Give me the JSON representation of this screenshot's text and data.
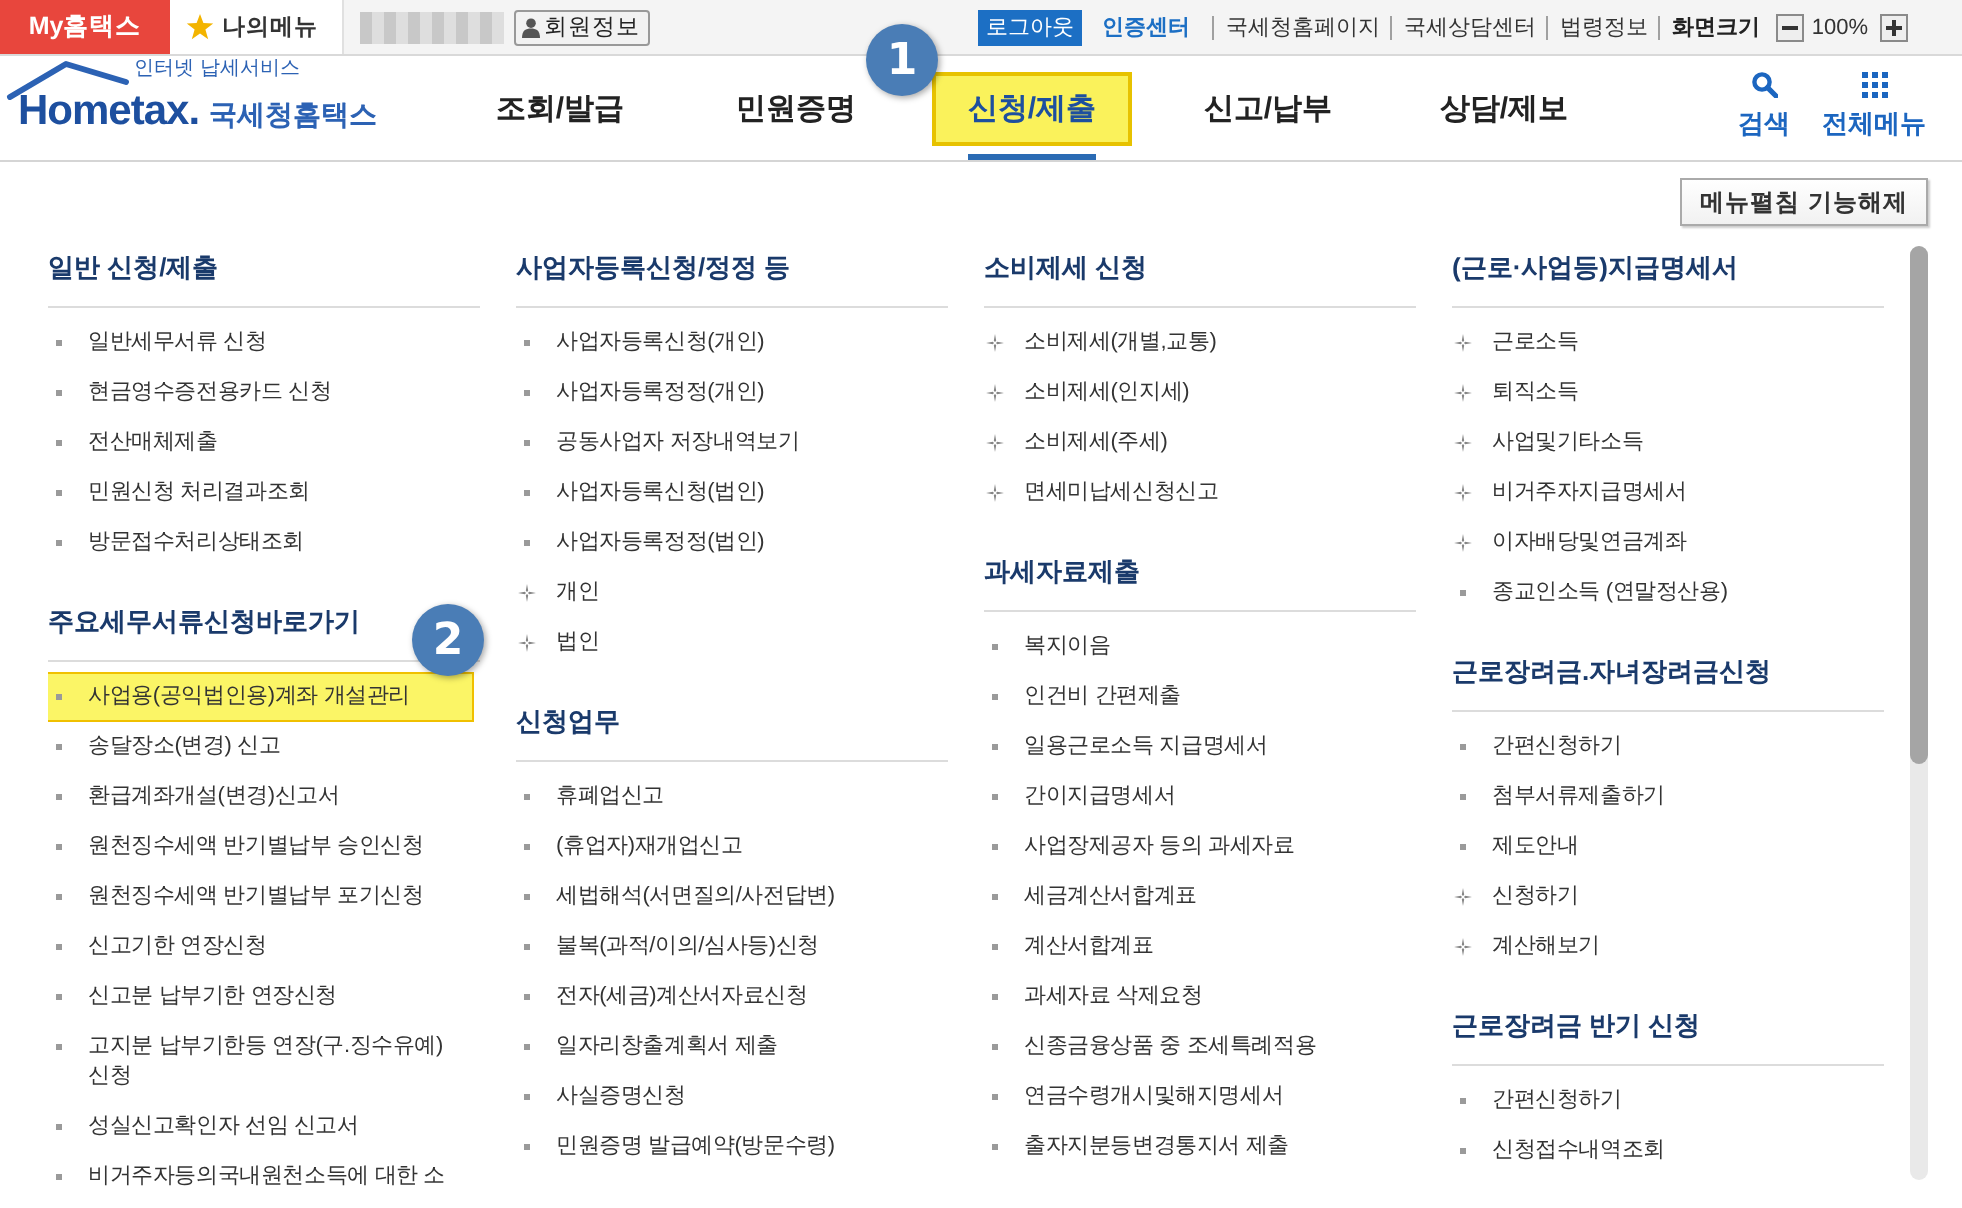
{
  "top_bar": {
    "my_hometax": "My홈택스",
    "my_menu": "나의메뉴",
    "member_info": "회원정보",
    "logout": "로그아웃",
    "cert_center": "인증센터",
    "links": [
      "국세청홈페이지",
      "국세상담센터",
      "법령정보"
    ],
    "screen_size": {
      "label": "화면크기",
      "value": "100%"
    }
  },
  "logo": {
    "tagline": "인터넷 납세서비스",
    "wordmark": "Hometax.",
    "title": "국세청홈택스"
  },
  "nav": {
    "tabs": [
      {
        "label": "조회/발급",
        "selected": false
      },
      {
        "label": "민원증명",
        "selected": false
      },
      {
        "label": "신청/제출",
        "selected": true,
        "marker": "1"
      },
      {
        "label": "신고/납부",
        "selected": false
      },
      {
        "label": "상담/제보",
        "selected": false
      }
    ],
    "search": "검색",
    "all_menu": "전체메뉴"
  },
  "collapse_button": "메뉴펼침 기능해제",
  "columns": [
    {
      "sections": [
        {
          "title": "일반 신청/제출",
          "items": [
            {
              "label": "일반세무서류 신청",
              "kind": "page",
              "highlighted": false
            },
            {
              "label": "현금영수증전용카드 신청",
              "kind": "page",
              "highlighted": false
            },
            {
              "label": "전산매체제출",
              "kind": "page",
              "highlighted": false
            },
            {
              "label": "민원신청 처리결과조회",
              "kind": "page",
              "highlighted": false
            },
            {
              "label": "방문접수처리상태조회",
              "kind": "page",
              "highlighted": false
            }
          ]
        },
        {
          "title": "주요세무서류신청바로가기",
          "items": [
            {
              "label": "사업용(공익법인용)계좌 개설관리",
              "kind": "page",
              "highlighted": true,
              "marker": "2"
            },
            {
              "label": "송달장소(변경) 신고",
              "kind": "page",
              "highlighted": false
            },
            {
              "label": "환급계좌개설(변경)신고서",
              "kind": "page",
              "highlighted": false
            },
            {
              "label": "원천징수세액 반기별납부 승인신청",
              "kind": "page",
              "highlighted": false
            },
            {
              "label": "원천징수세액 반기별납부 포기신청",
              "kind": "page",
              "highlighted": false
            },
            {
              "label": "신고기한 연장신청",
              "kind": "page",
              "highlighted": false
            },
            {
              "label": "신고분 납부기한 연장신청",
              "kind": "page",
              "highlighted": false
            },
            {
              "label": "고지분 납부기한등 연장(구.징수유예) 신청",
              "kind": "page",
              "highlighted": false
            },
            {
              "label": "성실신고확인자 선임 신고서",
              "kind": "page",
              "highlighted": false
            },
            {
              "label": "비거주자등의국내원천소득에 대한 소",
              "kind": "page",
              "highlighted": false
            }
          ]
        }
      ]
    },
    {
      "sections": [
        {
          "title": "사업자등록신청/정정 등",
          "items": [
            {
              "label": "사업자등록신청(개인)",
              "kind": "page",
              "highlighted": false
            },
            {
              "label": "사업자등록정정(개인)",
              "kind": "page",
              "highlighted": false
            },
            {
              "label": "공동사업자 저장내역보기",
              "kind": "page",
              "highlighted": false
            },
            {
              "label": "사업자등록신청(법인)",
              "kind": "page",
              "highlighted": false
            },
            {
              "label": "사업자등록정정(법인)",
              "kind": "page",
              "highlighted": false
            },
            {
              "label": "개인",
              "kind": "group",
              "highlighted": false
            },
            {
              "label": "법인",
              "kind": "group",
              "highlighted": false
            }
          ]
        },
        {
          "title": "신청업무",
          "items": [
            {
              "label": "휴폐업신고",
              "kind": "page",
              "highlighted": false
            },
            {
              "label": "(휴업자)재개업신고",
              "kind": "page",
              "highlighted": false
            },
            {
              "label": "세법해석(서면질의/사전답변)",
              "kind": "page",
              "highlighted": false
            },
            {
              "label": "불복(과적/이의/심사등)신청",
              "kind": "page",
              "highlighted": false
            },
            {
              "label": "전자(세금)계산서자료신청",
              "kind": "page",
              "highlighted": false
            },
            {
              "label": "일자리창출계획서 제출",
              "kind": "page",
              "highlighted": false
            },
            {
              "label": "사실증명신청",
              "kind": "page",
              "highlighted": false
            },
            {
              "label": "민원증명 발급예약(방문수령)",
              "kind": "page",
              "highlighted": false
            }
          ]
        }
      ]
    },
    {
      "sections": [
        {
          "title": "소비제세 신청",
          "items": [
            {
              "label": "소비제세(개별,교통)",
              "kind": "group",
              "highlighted": false
            },
            {
              "label": "소비제세(인지세)",
              "kind": "group",
              "highlighted": false
            },
            {
              "label": "소비제세(주세)",
              "kind": "group",
              "highlighted": false
            },
            {
              "label": "면세미납세신청신고",
              "kind": "group",
              "highlighted": false
            }
          ]
        },
        {
          "title": "과세자료제출",
          "items": [
            {
              "label": "복지이음",
              "kind": "page",
              "highlighted": false
            },
            {
              "label": "인건비 간편제출",
              "kind": "page",
              "highlighted": false
            },
            {
              "label": "일용근로소득 지급명세서",
              "kind": "page",
              "highlighted": false
            },
            {
              "label": "간이지급명세서",
              "kind": "page",
              "highlighted": false
            },
            {
              "label": "사업장제공자 등의 과세자료",
              "kind": "page",
              "highlighted": false
            },
            {
              "label": "세금계산서합계표",
              "kind": "page",
              "highlighted": false
            },
            {
              "label": "계산서합계표",
              "kind": "page",
              "highlighted": false
            },
            {
              "label": "과세자료 삭제요청",
              "kind": "page",
              "highlighted": false
            },
            {
              "label": "신종금융상품 중 조세특례적용",
              "kind": "page",
              "highlighted": false
            },
            {
              "label": "연금수령개시및해지명세서",
              "kind": "page",
              "highlighted": false
            },
            {
              "label": "출자지분등변경통지서 제출",
              "kind": "page",
              "highlighted": false
            }
          ]
        }
      ]
    },
    {
      "sections": [
        {
          "title": "(근로·사업등)지급명세서",
          "items": [
            {
              "label": "근로소득",
              "kind": "group",
              "highlighted": false
            },
            {
              "label": "퇴직소득",
              "kind": "group",
              "highlighted": false
            },
            {
              "label": "사업및기타소득",
              "kind": "group",
              "highlighted": false
            },
            {
              "label": "비거주자지급명세서",
              "kind": "group",
              "highlighted": false
            },
            {
              "label": "이자배당및연금계좌",
              "kind": "group",
              "highlighted": false
            },
            {
              "label": "종교인소득 (연말정산용)",
              "kind": "page",
              "highlighted": false
            }
          ]
        },
        {
          "title": "근로장려금.자녀장려금신청",
          "items": [
            {
              "label": "간편신청하기",
              "kind": "page",
              "highlighted": false
            },
            {
              "label": "첨부서류제출하기",
              "kind": "page",
              "highlighted": false
            },
            {
              "label": "제도안내",
              "kind": "page",
              "highlighted": false
            },
            {
              "label": "신청하기",
              "kind": "group",
              "highlighted": false
            },
            {
              "label": "계산해보기",
              "kind": "group",
              "highlighted": false
            }
          ]
        },
        {
          "title": "근로장려금 반기 신청",
          "items": [
            {
              "label": "간편신청하기",
              "kind": "page",
              "highlighted": false
            },
            {
              "label": "신청접수내역조회",
              "kind": "page",
              "highlighted": false
            }
          ]
        }
      ]
    }
  ]
}
